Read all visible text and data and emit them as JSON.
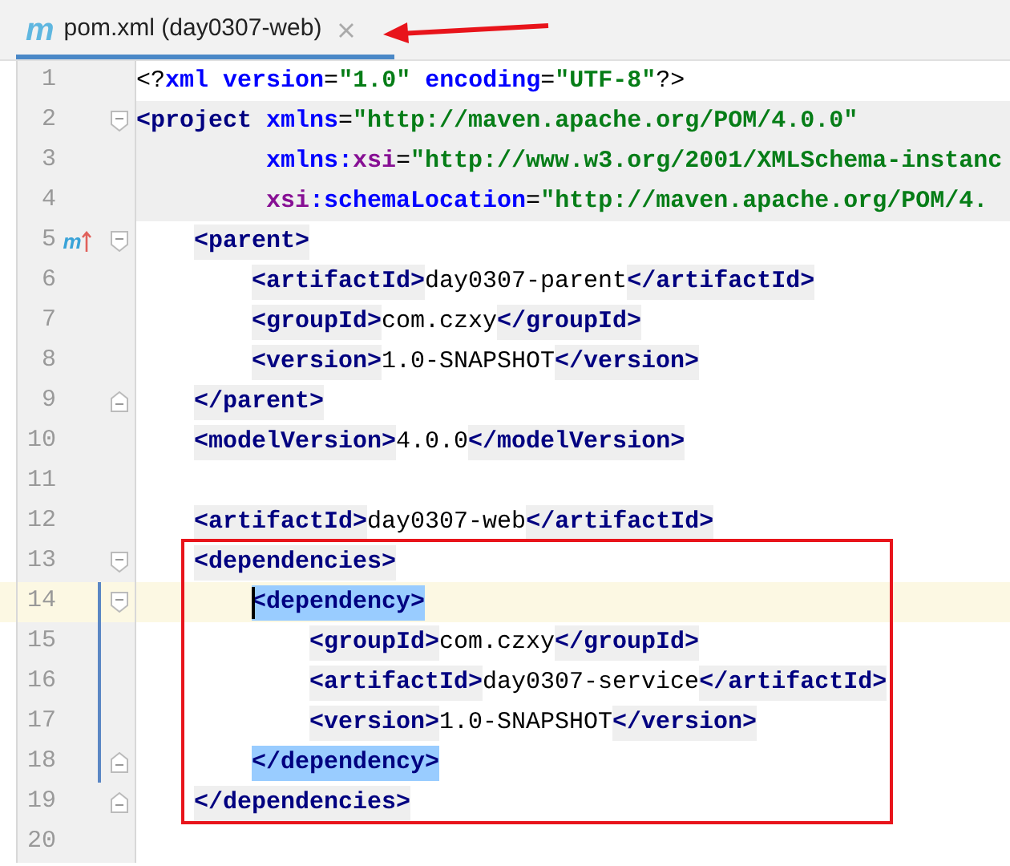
{
  "tab": {
    "icon": "m",
    "title": "pom.xml (day0307-web)",
    "selected": true
  },
  "lines": [
    {
      "number": "1",
      "fold_start": false,
      "fold_end": false,
      "shaded": false,
      "current": false,
      "in_scope": false,
      "continuation": false,
      "segments": [
        {
          "kind": "punct",
          "text": "<?"
        },
        {
          "kind": "attr",
          "text": "xml version"
        },
        {
          "kind": "punct",
          "text": "="
        },
        {
          "kind": "value",
          "text": "\"1.0\""
        },
        {
          "kind": "attr",
          "text": " encoding"
        },
        {
          "kind": "punct",
          "text": "="
        },
        {
          "kind": "value",
          "text": "\"UTF-8\""
        },
        {
          "kind": "punct",
          "text": "?>"
        }
      ]
    },
    {
      "number": "2",
      "fold_start": true,
      "fold_end": false,
      "shaded": true,
      "current": false,
      "in_scope": false,
      "continuation": false,
      "segments": [
        {
          "kind": "tag",
          "text": "<project"
        },
        {
          "kind": "attr",
          "text": " xmlns"
        },
        {
          "kind": "punct",
          "text": "="
        },
        {
          "kind": "value",
          "text": "\"http://maven.apache.org/POM/4.0.0\""
        }
      ],
      "children": [
        {
          "number": "3",
          "fold_start": false,
          "fold_end": false,
          "shaded": true,
          "current": false,
          "in_scope": false,
          "continuation": true,
          "segments": [
            {
              "kind": "attr",
              "text": "xmlns:"
            },
            {
              "kind": "ns",
              "text": "xsi"
            },
            {
              "kind": "punct",
              "text": "="
            },
            {
              "kind": "value",
              "text": "\"http://www.w3.org/2001/XMLSchema-instanc"
            }
          ]
        },
        {
          "number": "4",
          "fold_start": false,
          "fold_end": false,
          "shaded": true,
          "current": false,
          "in_scope": false,
          "continuation": true,
          "segments": [
            {
              "kind": "ns",
              "text": "xsi"
            },
            {
              "kind": "attr",
              "text": ":schemaLocation"
            },
            {
              "kind": "punct",
              "text": "="
            },
            {
              "kind": "value",
              "text": "\"http://maven.apache.org/POM/4."
            }
          ]
        },
        {
          "number": "5",
          "fold_start": true,
          "fold_end": false,
          "override_mark": "m",
          "shaded": false,
          "current": false,
          "in_scope": false,
          "continuation": false,
          "segments": [
            {
              "kind": "tag",
              "text": "<parent>"
            }
          ],
          "children": [
            {
              "number": "6",
              "fold_start": false,
              "fold_end": false,
              "shaded": false,
              "current": false,
              "in_scope": false,
              "continuation": false,
              "segments": [
                {
                  "kind": "tag",
                  "text": "<artifactId>"
                },
                {
                  "kind": "text",
                  "text": "day0307-parent"
                },
                {
                  "kind": "tag",
                  "text": "</artifactId>"
                }
              ]
            },
            {
              "number": "7",
              "fold_start": false,
              "fold_end": false,
              "shaded": false,
              "current": false,
              "in_scope": false,
              "continuation": false,
              "segments": [
                {
                  "kind": "tag",
                  "text": "<groupId>"
                },
                {
                  "kind": "text",
                  "text": "com.czxy"
                },
                {
                  "kind": "tag",
                  "text": "</groupId>"
                }
              ]
            },
            {
              "number": "8",
              "fold_start": false,
              "fold_end": false,
              "shaded": false,
              "current": false,
              "in_scope": false,
              "continuation": false,
              "segments": [
                {
                  "kind": "tag",
                  "text": "<version>"
                },
                {
                  "kind": "text",
                  "text": "1.0-SNAPSHOT"
                },
                {
                  "kind": "tag",
                  "text": "</version>"
                }
              ]
            }
          ]
        },
        {
          "number": "9",
          "fold_start": false,
          "fold_end": true,
          "shaded": false,
          "current": false,
          "in_scope": false,
          "continuation": false,
          "segments": [
            {
              "kind": "tag",
              "text": "</parent>"
            }
          ]
        },
        {
          "number": "10",
          "fold_start": false,
          "fold_end": false,
          "shaded": false,
          "current": false,
          "in_scope": false,
          "continuation": false,
          "segments": [
            {
              "kind": "tag",
              "text": "<modelVersion>"
            },
            {
              "kind": "text",
              "text": "4.0.0"
            },
            {
              "kind": "tag",
              "text": "</modelVersion>"
            }
          ]
        },
        {
          "number": "11",
          "fold_start": false,
          "fold_end": false,
          "shaded": false,
          "current": false,
          "in_scope": false,
          "continuation": false
        },
        {
          "number": "12",
          "fold_start": false,
          "fold_end": false,
          "shaded": false,
          "current": false,
          "in_scope": false,
          "continuation": false,
          "segments": [
            {
              "kind": "tag",
              "text": "<artifactId>"
            },
            {
              "kind": "text",
              "text": "day0307-web"
            },
            {
              "kind": "tag",
              "text": "</artifactId>"
            }
          ]
        },
        {
          "number": "13",
          "fold_start": true,
          "fold_end": false,
          "shaded": false,
          "current": false,
          "in_scope": false,
          "continuation": false,
          "segments": [
            {
              "kind": "tag",
              "text": "<dependencies>"
            }
          ],
          "children": [
            {
              "number": "14",
              "fold_start": true,
              "fold_end": false,
              "shaded": false,
              "current": true,
              "in_scope": true,
              "continuation": false,
              "segments": [
                {
                  "kind": "tag_match",
                  "text": "<dependency>"
                }
              ],
              "children": [
                {
                  "number": "15",
                  "fold_start": false,
                  "fold_end": false,
                  "shaded": false,
                  "current": false,
                  "in_scope": true,
                  "continuation": false,
                  "segments": [
                    {
                      "kind": "tag",
                      "text": "<groupId>"
                    },
                    {
                      "kind": "text",
                      "text": "com.czxy"
                    },
                    {
                      "kind": "tag",
                      "text": "</groupId>"
                    }
                  ]
                },
                {
                  "number": "16",
                  "fold_start": false,
                  "fold_end": false,
                  "shaded": false,
                  "current": false,
                  "in_scope": true,
                  "continuation": false,
                  "segments": [
                    {
                      "kind": "tag",
                      "text": "<artifactId>"
                    },
                    {
                      "kind": "text",
                      "text": "day0307-service"
                    },
                    {
                      "kind": "tag",
                      "text": "</artifactId>"
                    }
                  ]
                },
                {
                  "number": "17",
                  "fold_start": false,
                  "fold_end": false,
                  "shaded": false,
                  "current": false,
                  "in_scope": true,
                  "continuation": false,
                  "segments": [
                    {
                      "kind": "tag",
                      "text": "<version>"
                    },
                    {
                      "kind": "text",
                      "text": "1.0-SNAPSHOT"
                    },
                    {
                      "kind": "tag",
                      "text": "</version>"
                    }
                  ]
                }
              ]
            },
            {
              "number": "18",
              "fold_start": false,
              "fold_end": true,
              "shaded": false,
              "current": false,
              "in_scope": true,
              "continuation": false,
              "segments": [
                {
                  "kind": "tag_match",
                  "text": "</dependency>"
                }
              ]
            }
          ]
        },
        {
          "number": "19",
          "fold_start": false,
          "fold_end": true,
          "shaded": false,
          "current": false,
          "in_scope": false,
          "continuation": false,
          "segments": [
            {
              "kind": "tag",
              "text": "</dependencies>"
            }
          ]
        },
        {
          "number": "20",
          "fold_start": false,
          "fold_end": false,
          "shaded": false,
          "current": false,
          "in_scope": false,
          "continuation": false
        }
      ]
    }
  ]
}
